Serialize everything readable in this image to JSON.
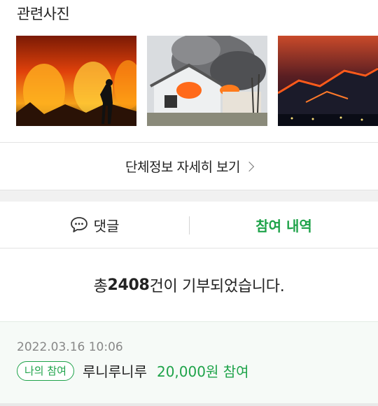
{
  "section": {
    "title": "관련사진"
  },
  "photos": [
    {
      "name": "wildfire-firefighter-photo"
    },
    {
      "name": "burning-house-photo"
    },
    {
      "name": "mountain-fire-night-photo"
    }
  ],
  "detail_link": {
    "label": "단체정보 자세히 보기"
  },
  "tabs": {
    "comments_label": "댓글",
    "history_label": "참여 내역"
  },
  "summary": {
    "prefix": "총 ",
    "count": "2408",
    "suffix": "건이 기부되었습니다."
  },
  "donations": [
    {
      "date": "2022.03.16 10:06",
      "badge": "나의 참여",
      "name": "루니루니루",
      "amount": "20,000원 참여"
    }
  ],
  "colors": {
    "accent": "#1fa34a",
    "text": "#222222",
    "muted": "#888888"
  }
}
